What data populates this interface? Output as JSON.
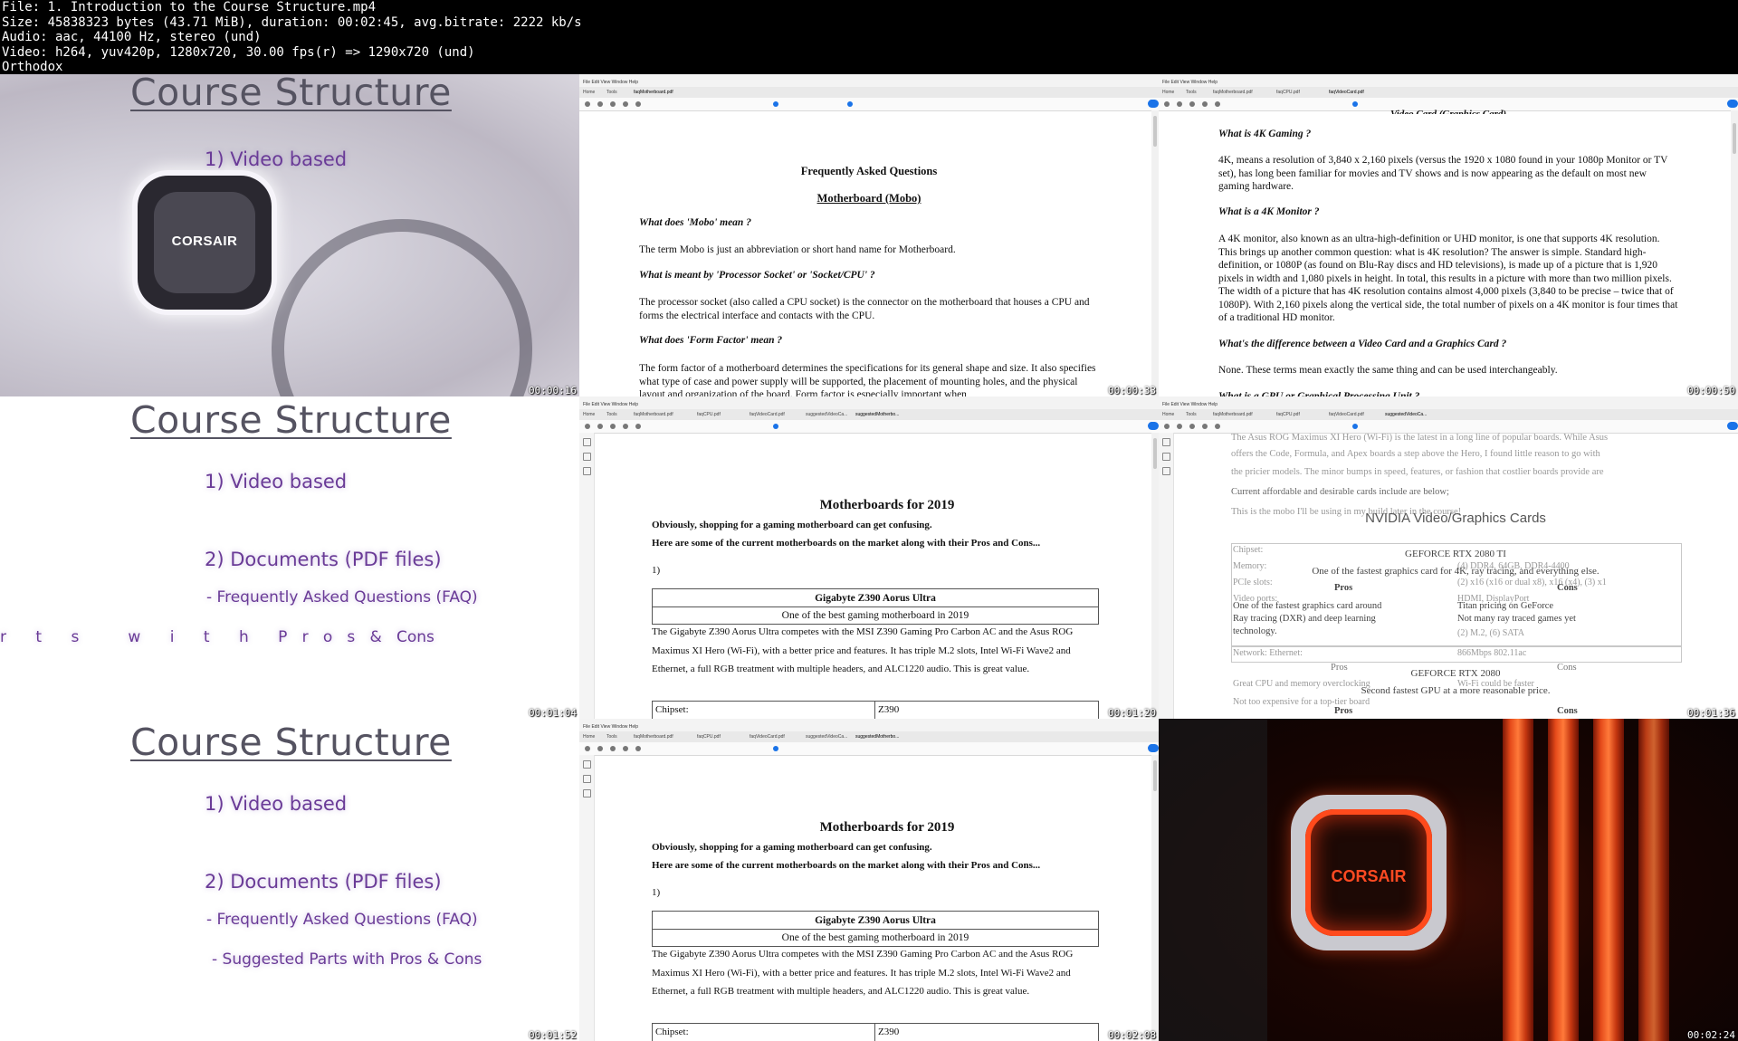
{
  "header": {
    "lines": [
      "File: 1. Introduction to the Course Structure.mp4",
      "Size: 45838323 bytes (43.71 MiB), duration: 00:02:45, avg.bitrate: 2222 kb/s",
      "Audio: aac, 44100 Hz, stereo (und)",
      "Video: h264, yuv420p, 1280x720, 30.00 fps(r) => 1290x720 (und)",
      "Orthodox"
    ]
  },
  "timestamps": [
    "00:00:16",
    "00:00:33",
    "00:00:50",
    "00:01:04",
    "00:01:20",
    "00:01:36",
    "00:01:52",
    "00:02:08",
    "00:02:24"
  ],
  "slide": {
    "title": "Course Structure",
    "item1": "1) Video based",
    "item2": "2) Documents (PDF files)",
    "item2a": "-  Frequently Asked Questions (FAQ)",
    "item2b_anim": "r      t      s          w      i      t      h      P   r   o   s   &   Cons",
    "item2b": "- Suggested Parts with Pros & Cons",
    "logo": "CORSAIR"
  },
  "pdf_chrome": {
    "menu": "File  Edit  View  Window  Help",
    "home": "Home",
    "tools": "Tools",
    "tab_mobo": "faqMotherboard.pdf",
    "tab_cpu": "faqCPU.pdf",
    "tab_video": "faqVideoCard.pdf",
    "tab_sugvideo": "suggestedVideoCa...",
    "tab_sugmobo": "suggestedMotherbo...",
    "sign": "Sign"
  },
  "faq_mobo": {
    "heading": "Frequently Asked Questions",
    "subheading": "Motherboard (Mobo)",
    "q1": "What does 'Mobo' mean ?",
    "a1": "The term Mobo is just an abbreviation or short hand name  for Motherboard.",
    "q2": "What is meant by 'Processor Socket' or 'Socket/CPU' ?",
    "a2": "The processor socket (also called a CPU socket) is the connector on the motherboard that houses a CPU and forms the electrical interface and contacts with the CPU.",
    "q3": "What does 'Form Factor' mean ?",
    "a3": "The form factor of a motherboard determines the specifications for its general shape and size. It also specifies what type of case and power supply will be supported, the placement of mounting holes, and the physical layout and organization of the board.  Form factor is especially important when"
  },
  "faq_video": {
    "top_cut": "Video Card (Graphics Card)",
    "q1": "What is 4K Gaming ?",
    "a1": "4K, means a resolution of 3,840 x 2,160 pixels (versus the 1920 x 1080 found in your 1080p Monitor or TV set), has long been familiar for movies and TV shows and is now appearing as the default on most new gaming hardware.",
    "q2": "What is a 4K Monitor ?",
    "a2": "A 4K monitor, also known as an ultra-high-definition or UHD monitor, is one that supports 4K resolution. This brings up another common question: what is 4K resolution? The answer is simple. Standard high-definition, or 1080P (as found on Blu-Ray discs and HD televisions), is made up of a picture that is 1,920 pixels in width and 1,080 pixels in height. In total, this results in a picture with more than two million pixels. The width of a picture that has 4K resolution contains almost 4,000 pixels (3,840 to be precise – twice that of 1080P). With 2,160 pixels along the vertical side, the total number of pixels on a 4K monitor is four times that of a traditional HD monitor.",
    "q3": "What's the difference between a Video Card and a Graphics Card ?",
    "a3": "None. These terms mean exactly the same thing and can be used interchangeably.",
    "q4_cut": "What is a GPU or Graphical Processing Unit ?"
  },
  "sug_mobo": {
    "heading": "Motherboards for 2019",
    "intro1": "Obviously, shopping for a gaming motherboard can get confusing.",
    "intro2": "Here are some of the current motherboards on the market along with their Pros and Cons...",
    "num": "1)",
    "board_name": "Gigabyte Z390 Aorus Ultra",
    "board_tag": "One of the best gaming motherboard in 2019",
    "desc": "The Gigabyte Z390 Aorus Ultra competes with the MSI Z390 Gaming Pro Carbon AC and the Asus ROG Maximus XI Hero (Wi-Fi), with a better price and features. It has triple M.2 slots, Intel Wi-Fi Wave2 and Ethernet, a full RGB treatment with multiple headers, and ALC1220 audio. This is great value.",
    "spec_label": "Chipset:",
    "spec_value": "Z390"
  },
  "transition": {
    "g1": "The Asus ROG Maximus XI Hero (Wi-Fi) is the latest in a long line of popular boards. While Asus",
    "g2": "offers the Code, Formula, and Apex boards a step above the Hero, I found little reason to go with",
    "g3": "the pricier models. The minor bumps in speed, features, or fashion that costlier boards provide are",
    "g4": "Current affordable and desirable cards include are below;",
    "g5": "This is the mobo I'll be using in my build later in the course!",
    "title": "NVIDIA Video/Graphics Cards",
    "card1": "GEFORCE RTX 2080 TI",
    "card1_tag": "One of the fastest graphics card for 4K, ray tracing, and everything else.",
    "pros": "Pros",
    "cons": "Cons",
    "pro1a": "One of the fastest graphics card around",
    "pro1b": "Ray tracing (DXR) and deep learning",
    "pro1c": "technology.",
    "con1a": "Titan pricing on GeForce",
    "con1b": "Not many ray traced games yet",
    "chipset": "Chipset:",
    "memory": "Memory:",
    "pcie": "PCIe slots:",
    "video_ports": "Video ports:",
    "mem_val": "(4) DDR4, 64GB, DDR4-4400",
    "pcie_val": "(2) x16 (x16 or dual x8), x16 (x4), (3) x1",
    "ports_val": "HDMI, DisplayPort",
    "storage_val": "(2) M.2, (6) SATA",
    "network": "Network: Ethernet:",
    "network_val": "866Mbps 802.11ac",
    "card2": "GEFORCE RTX 2080",
    "card2_tag": "Second fastest GPU at a more reasonable price.",
    "pro2": "Great CPU and memory overclocking",
    "con2": "Wi-Fi could be faster",
    "pro3": "Not too expensive for a top-tier board"
  }
}
